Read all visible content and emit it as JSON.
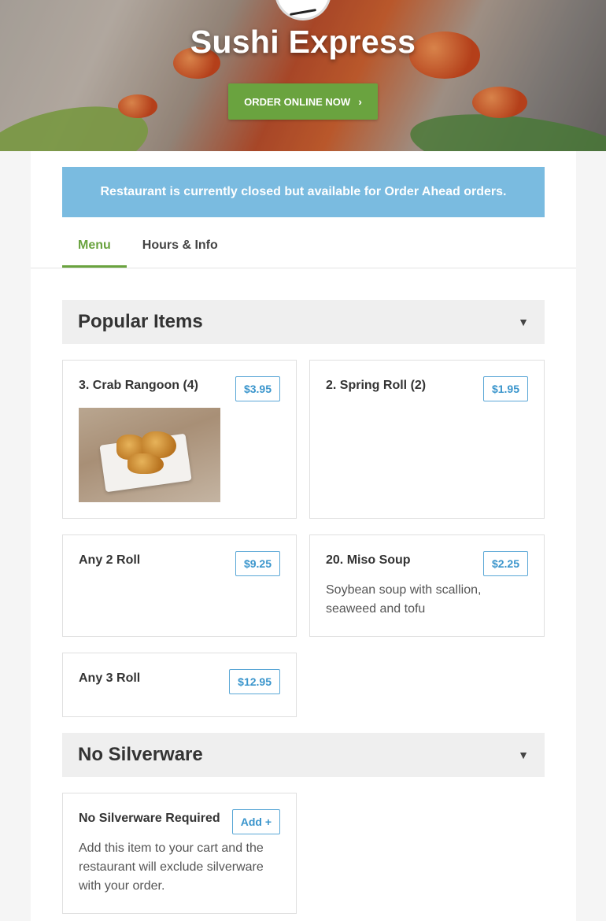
{
  "header": {
    "restaurant_name": "Sushi Express",
    "order_button": "ORDER ONLINE NOW",
    "order_chevron": "›"
  },
  "notice": "Restaurant is currently closed but available for Order Ahead orders.",
  "tabs": [
    {
      "label": "Menu",
      "active": true
    },
    {
      "label": "Hours & Info",
      "active": false
    }
  ],
  "sections": [
    {
      "title": "Popular Items",
      "caret": "▼",
      "items": [
        {
          "name": "3. Crab Rangoon (4)",
          "price": "$3.95",
          "has_image": true
        },
        {
          "name": "2. Spring Roll (2)",
          "price": "$1.95"
        },
        {
          "name": "Any 2 Roll",
          "price": "$9.25"
        },
        {
          "name": "20. Miso Soup",
          "price": "$2.25",
          "description": "Soybean soup with scallion, seaweed and tofu"
        },
        {
          "name": "Any 3 Roll",
          "price": "$12.95"
        }
      ]
    },
    {
      "title": "No Silverware",
      "caret": "▼",
      "items": [
        {
          "name": "No Silverware Required",
          "price": "Add +",
          "description": "Add this item to your cart and the restaurant will exclude silverware with your order."
        }
      ]
    }
  ],
  "colors": {
    "accent_green": "#6aa33f",
    "notice_blue": "#7abbe0",
    "price_blue": "#3a95cc"
  }
}
